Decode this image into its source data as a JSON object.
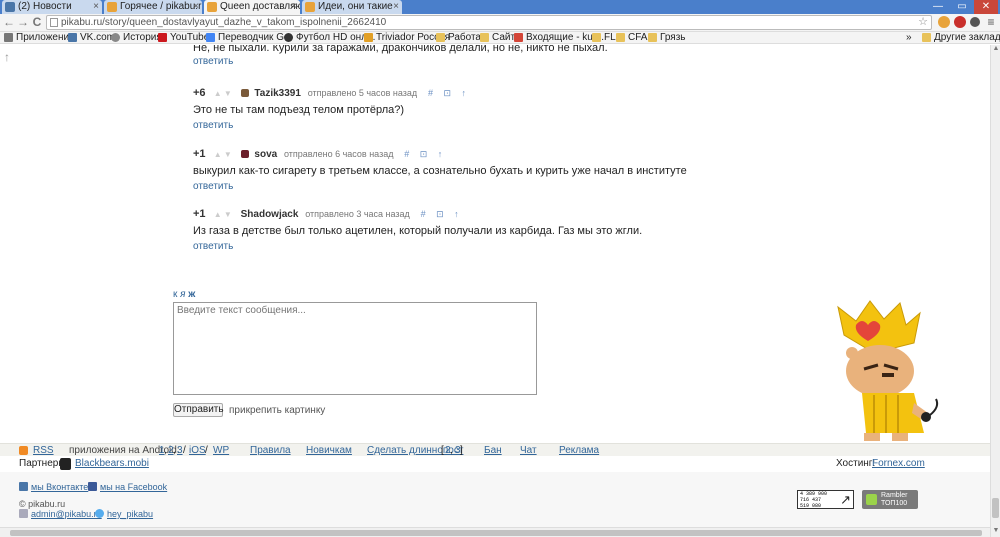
{
  "browser": {
    "tabs": [
      {
        "title": "(2) Новости",
        "icon_color": "#4a76a8"
      },
      {
        "title": "Горячее / pikabu.ru",
        "icon_color": "#e8a33a"
      },
      {
        "title": "Queen доставляют в",
        "icon_color": "#e8a33a"
      },
      {
        "title": "Идеи, они такие",
        "icon_color": "#e8a33a"
      }
    ],
    "tab_close": "×",
    "window_controls": {
      "minimize": "—",
      "maximize": "▭",
      "close": "✕"
    },
    "address": "pikabu.ru/story/queen_dostavlyayut_dazhe_v_takom_ispolnenii_2662410",
    "nav": {
      "back": "←",
      "forward": "→",
      "reload": "C"
    },
    "star": "☆",
    "menu": "≡"
  },
  "bookmarks": {
    "items": [
      {
        "label": "Приложения",
        "icon_color": "#777777"
      },
      {
        "label": "VK.com",
        "icon_color": "#4a76a8"
      },
      {
        "label": "История",
        "icon_color": "#888888"
      },
      {
        "label": "YouTube",
        "icon_color": "#cc181e"
      },
      {
        "label": "Переводчик G...",
        "icon_color": "#4285f4"
      },
      {
        "label": "Футбол HD онл...",
        "icon_color": "#333333"
      },
      {
        "label": "Triviador Россия",
        "icon_color": "#e2a026"
      },
      {
        "label": "Работа",
        "icon_color": "#e8c25a"
      },
      {
        "label": "Сайт",
        "icon_color": "#e8c25a"
      },
      {
        "label": "Входящие - kur...",
        "icon_color": "#d44638"
      },
      {
        "label": "FL",
        "icon_color": "#e8c25a"
      },
      {
        "label": "CFA",
        "icon_color": "#e8c25a"
      },
      {
        "label": "Грязь",
        "icon_color": "#e8c25a"
      }
    ],
    "other": "Другие закладки",
    "more": "»"
  },
  "page": {
    "scroll_up": "↑",
    "first_line": "Не, не пыхали. Курили за гаражами, дракончиков делали, но не, никто не пыхал.",
    "reply_label": "ответить",
    "comments": [
      {
        "rating": "+6",
        "author": "Tazik3391",
        "time": "отправлено 5 часов назад",
        "actions": "# ⊡ ↑",
        "text": "Это не ты там подъезд телом протёрла?)",
        "avatar_color": "#7a5a3a"
      },
      {
        "rating": "+1",
        "author": "sova",
        "time": "отправлено 6 часов назад",
        "actions": "# ⊡ ↑",
        "text": "выкурил как-то сигарету в третьем классе, а сознательно бухать и курить уже начал в институте",
        "avatar_color": "#6b1f2a"
      },
      {
        "rating": "+1",
        "author": "Shadowjack",
        "time": "отправлено 3 часа назад",
        "actions": "# ⊡ ↑",
        "text": "Из газа в детстве был только ацетилен, который получали из карбида. Газ мы это жгли.",
        "avatar_color": ""
      }
    ],
    "vote_arrows": "▲ ▼",
    "format_buttons": {
      "k": "к",
      "ya": "я",
      "zh": "ж"
    },
    "message_placeholder": "Введите текст сообщения...",
    "send_button": "Отправить",
    "attach_label": "прикрепить картинку"
  },
  "footer": {
    "rss": "RSS",
    "apps_label": "приложения на Android:",
    "android_links": [
      "1",
      "2",
      "3"
    ],
    "ios": "iOS",
    "wp": "WP",
    "links": [
      "Правила",
      "Новичкам",
      "Сделать длиннопост",
      "Бан",
      "Чат",
      "Реклама"
    ],
    "longpost_links": [
      "2",
      "3"
    ],
    "partners_label": "Партнеры:",
    "partner": "Blackbears.mobi",
    "hosting_label": "Хостинг:",
    "hosting": "Fornex.com",
    "vk": "мы Вконтакте",
    "facebook": "мы на Facebook",
    "copyright": "© pikabu.ru",
    "email": "admin@pikabu.ru",
    "twitter": "hey_pikabu",
    "counter_digits": [
      "4 389 900",
      "716 437",
      "519 080"
    ],
    "rambler": [
      "Rambler",
      "ТОП100"
    ]
  },
  "colors": {
    "link": "#336699",
    "tabstrip": "#4a7fcb",
    "accent": "#e8a33a"
  }
}
